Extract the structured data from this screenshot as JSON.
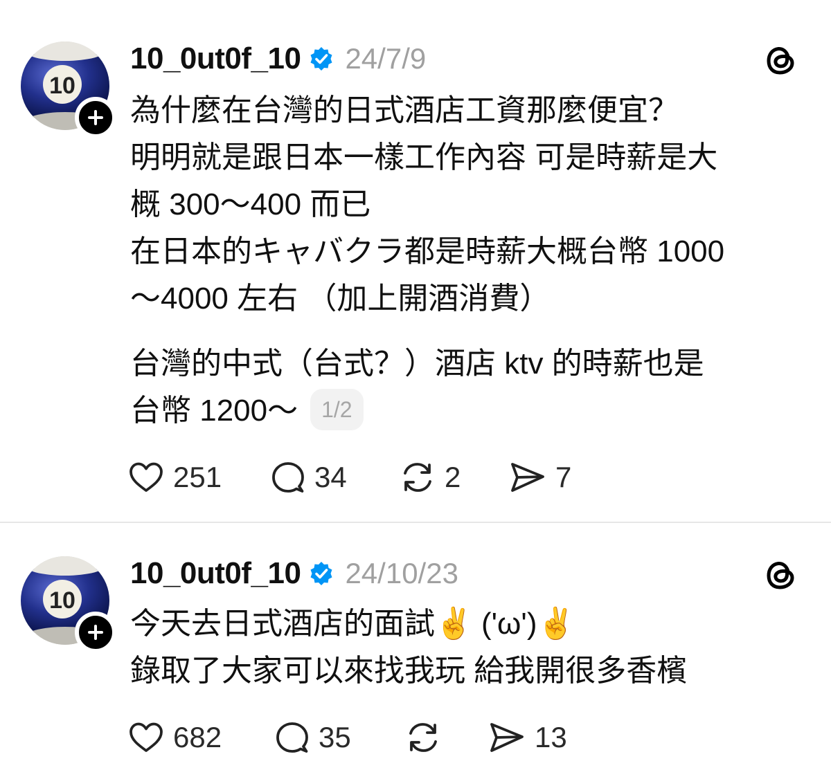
{
  "posts": [
    {
      "username": "10_0ut0f_10",
      "date": "24/7/9",
      "avatar_label": "10",
      "lines": [
        "為什麼在台灣的日式酒店工資那麼便宜？",
        "明明就是跟日本一樣工作內容 可是時薪是大",
        "概 300～400 而已",
        "在日本的キャバクラ都是時薪大概台幣 1000",
        "～4000 左右 （加上開酒消費）",
        "",
        "台灣的中式（台式？）酒店 ktv 的時薪也是",
        "台幣 1200～"
      ],
      "page_indicator": "1/2",
      "likes": "251",
      "replies": "34",
      "reposts": "2",
      "shares": "7"
    },
    {
      "username": "10_0ut0f_10",
      "date": "24/10/23",
      "avatar_label": "10",
      "lines": [
        "今天去日式酒店的面試✌️ ('ω')✌️",
        "錄取了大家可以來找我玩 給我開很多香檳"
      ],
      "likes": "682",
      "replies": "35",
      "reposts": "",
      "shares": "13"
    }
  ],
  "icons": {
    "verified": "verified-badge-icon",
    "follow": "plus-icon",
    "app": "threads-logo-icon",
    "like": "heart-icon",
    "reply": "comment-icon",
    "repost": "repost-icon",
    "share": "send-icon"
  },
  "colors": {
    "verified_blue": "#0095f6",
    "muted_text": "#a0a0a0",
    "text": "#101010",
    "ball_blue": "#1f2f86"
  }
}
